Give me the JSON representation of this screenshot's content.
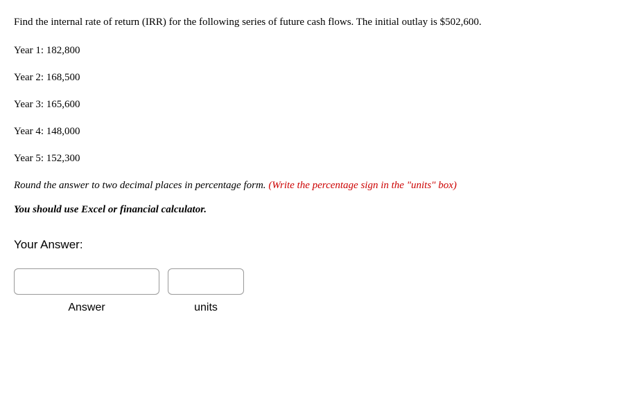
{
  "question": {
    "intro": "Find the internal rate of return (IRR) for the following series of future cash flows. The initial outlay is $502,600.",
    "cashflows": [
      "Year 1: 182,800",
      "Year 2: 168,500",
      "Year 3: 165,600",
      "Year 4: 148,000",
      "Year 5: 152,300"
    ],
    "round_instruction_black": "Round the answer to two decimal places in percentage form. ",
    "round_instruction_red": "(Write the percentage sign in the \"units\" box)",
    "calculator_note": "You should use Excel or financial calculator."
  },
  "answer": {
    "section_label": "Your Answer:",
    "answer_label": "Answer",
    "units_label": "units",
    "answer_value": "",
    "units_value": ""
  }
}
